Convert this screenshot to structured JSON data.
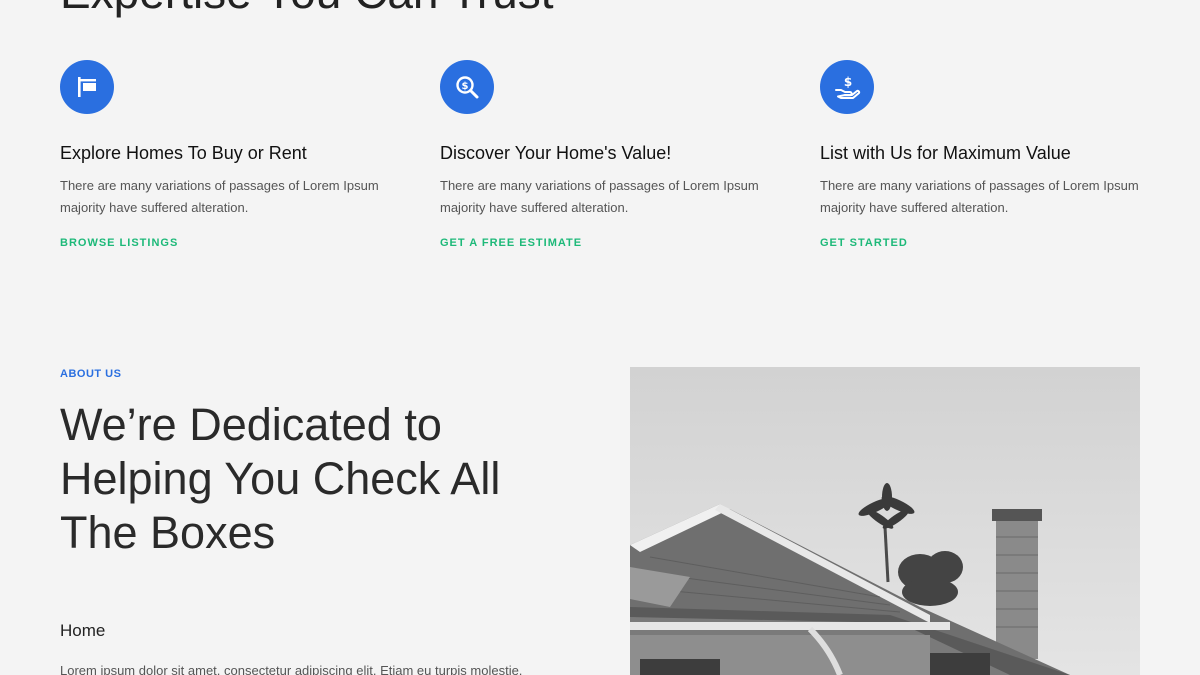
{
  "top_section": {
    "heading": "Expertise You Can Trust"
  },
  "features": [
    {
      "icon": "sign-icon",
      "title": "Explore Homes To Buy or Rent",
      "description": "There are many variations of passages of Lorem Ipsum majority have suffered alteration.",
      "link": "BROWSE LISTINGS"
    },
    {
      "icon": "dollar-search-icon",
      "title": "Discover Your Home's Value!",
      "description": "There are many variations of passages of Lorem Ipsum majority have suffered alteration.",
      "link": "GET A FREE ESTIMATE"
    },
    {
      "icon": "hand-dollar-icon",
      "title": "List with Us for Maximum Value",
      "description": "There are many variations of passages of Lorem Ipsum majority have suffered alteration.",
      "link": "GET STARTED"
    }
  ],
  "about": {
    "label": "ABOUT US",
    "heading": "We’re Dedicated to Helping You Check All The Boxes",
    "subheading": "Home",
    "body": "Lorem ipsum dolor sit amet, consectetur adipiscing elit. Etiam eu turpis molestie,"
  },
  "colors": {
    "background": "#f4f4f4",
    "icon_circle": "#2a6fe0",
    "link_green": "#1db979",
    "label_blue": "#2a6fe0"
  }
}
